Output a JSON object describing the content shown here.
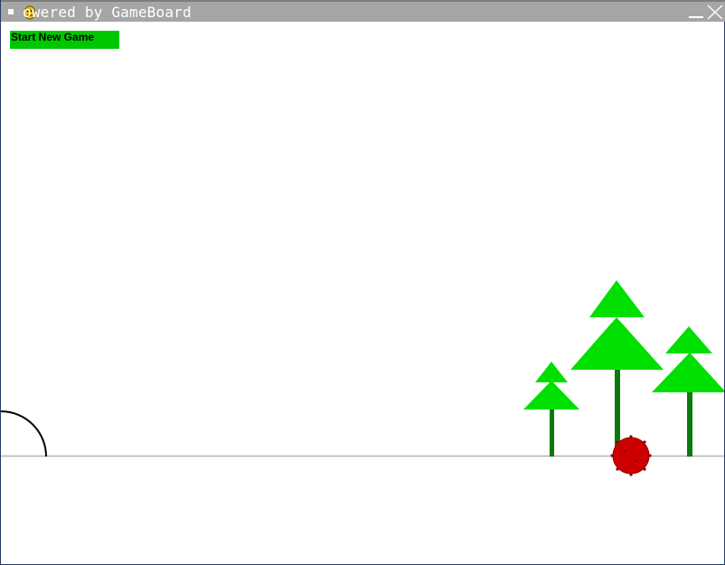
{
  "window": {
    "title": "owered by GameBoard"
  },
  "toolbar": {
    "new_game_label": "Start New Game"
  },
  "colors": {
    "titlebar": "#a6a6a6",
    "button": "#00c800",
    "tree_leaves": "#00e000",
    "tree_trunk": "#0b7a0b",
    "ball": "#cc0000",
    "ground": "#b4b4b4"
  },
  "icons": [
    "app-icon",
    "window-menu-icon",
    "minimize-icon",
    "close-icon"
  ]
}
